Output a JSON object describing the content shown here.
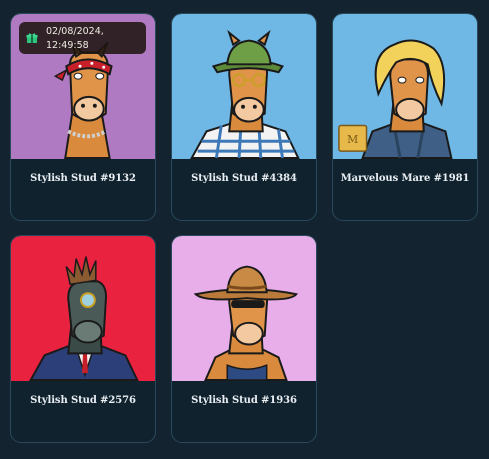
{
  "cards": [
    {
      "title": "Stylish Stud #9132",
      "bg": "#b07ac2"
    },
    {
      "title": "Stylish Stud #4384",
      "bg": "#6fb7e4"
    },
    {
      "title": "Marvelous Mare #1981",
      "bg": "#6fb7e4"
    },
    {
      "title": "Stylish Stud #2576",
      "bg": "#e8223f"
    },
    {
      "title": "Stylish Stud #1936",
      "bg": "#e8aee9"
    }
  ],
  "gift_badge": {
    "icon": "gift-icon",
    "date": "02/08/2024,",
    "time": "12:49:58"
  },
  "colors": {
    "page_bg": "#132430",
    "card_bg": "#10222e",
    "card_border": "#2a4a5c",
    "title_text": "#e8eef2"
  }
}
